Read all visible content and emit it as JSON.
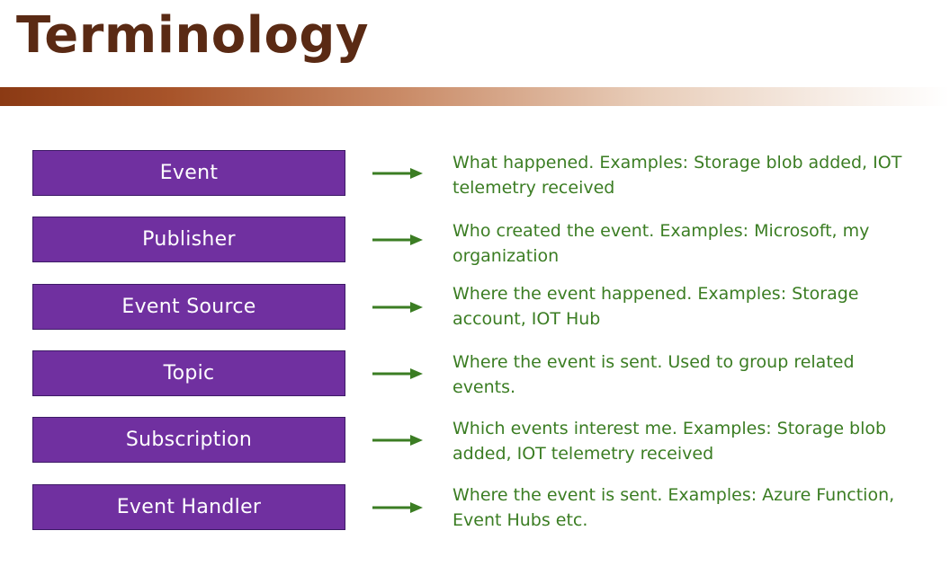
{
  "slide": {
    "title": "Terminology"
  },
  "terms": [
    {
      "label": "Event",
      "description": "What happened. Examples: Storage blob added, IOT telemetry received"
    },
    {
      "label": "Publisher",
      "description": "Who created the event. Examples: Microsoft, my organization"
    },
    {
      "label": "Event Source",
      "description": "Where the event happened. Examples: Storage account, IOT Hub"
    },
    {
      "label": "Topic",
      "description": "Where the event is sent. Used to group related events."
    },
    {
      "label": "Subscription",
      "description": "Which events interest me. Examples: Storage blob added, IOT telemetry received"
    },
    {
      "label": "Event Handler",
      "description": "Where the event is sent. Examples: Azure Function, Event Hubs etc."
    }
  ],
  "colors": {
    "title": "#5a2a14",
    "term_box": "#7030a0",
    "arrow": "#3b7d23",
    "description": "#3b7d23"
  },
  "icons": {
    "arrow": "right-arrow-icon"
  }
}
